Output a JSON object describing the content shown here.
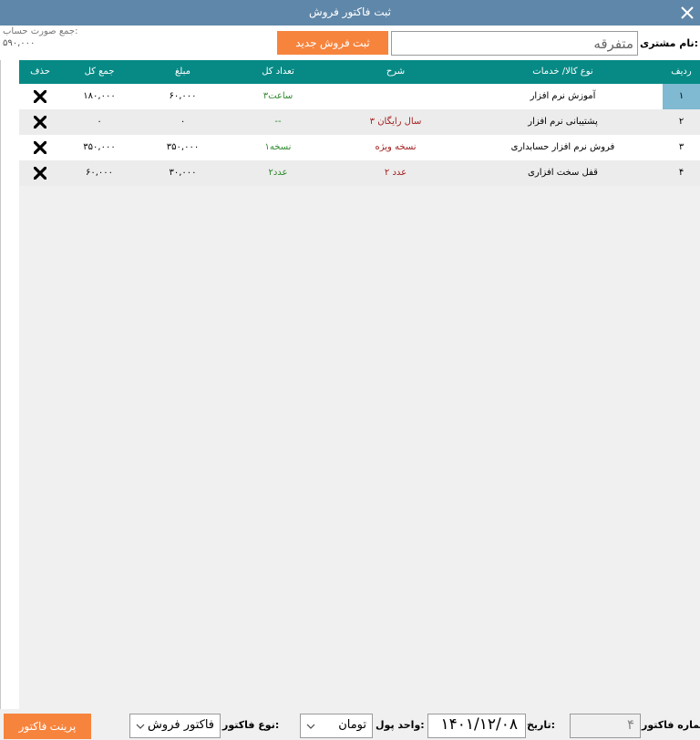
{
  "window": {
    "title": "ثبت فاکتور فروش"
  },
  "header": {
    "total_label": "جمع صورت حساب:",
    "total_value": "۵۹۰,۰۰۰",
    "new_sale_button": "ثبت فروش جدید",
    "customer_label": "نام مشتری:",
    "customer_value": "متفرقه"
  },
  "table": {
    "columns": [
      "ردیف",
      "نوع کالا/ خدمات",
      "شرح",
      "تعداد کل",
      "مبلغ",
      "جمع کل",
      "حذف"
    ],
    "rows": [
      {
        "no": "۱",
        "item": "آموزش نرم افزار",
        "desc": "",
        "qty": "۳ساعت",
        "price": "۶۰,۰۰۰",
        "total": "۱۸۰,۰۰۰"
      },
      {
        "no": "۲",
        "item": "پشتیبانی نرم افزار",
        "desc": "۳ سال رایگان",
        "qty": "--",
        "price": "۰",
        "total": "۰"
      },
      {
        "no": "۳",
        "item": "فروش نرم افزار حسابداری",
        "desc": "نسخه ویژه",
        "qty": "۱نسخه",
        "price": "۳۵۰,۰۰۰",
        "total": "۳۵۰,۰۰۰"
      },
      {
        "no": "۴",
        "item": "قفل سخت افزاری",
        "desc": "۲ عدد",
        "qty": "۲عدد",
        "price": "۳۰,۰۰۰",
        "total": "۶۰,۰۰۰"
      }
    ]
  },
  "footer": {
    "invoice_no_label": "شماره فاکتور:",
    "invoice_no_value": "۴",
    "date_label": "تاریخ:",
    "date_value": "۱۴۰۱/۱۲/۰۸",
    "currency_label": "واحد پول:",
    "currency_value": "تومان",
    "invoice_type_label": "نوع فاکتور:",
    "invoice_type_value": "فاکتور فروش",
    "print_button": "پرینت فاکتور"
  },
  "colors": {
    "titlebar": "#5f87a9",
    "accent_button": "#f7843d",
    "grid_header": "#078a85",
    "selected_row_number": "#7fb9d2",
    "quantity_text": "#2d8a2d",
    "description_text": "#a31f1f"
  },
  "icons": {
    "close": "close-icon",
    "delete": "delete-x-icon",
    "dropdown": "chevron-down-icon"
  }
}
